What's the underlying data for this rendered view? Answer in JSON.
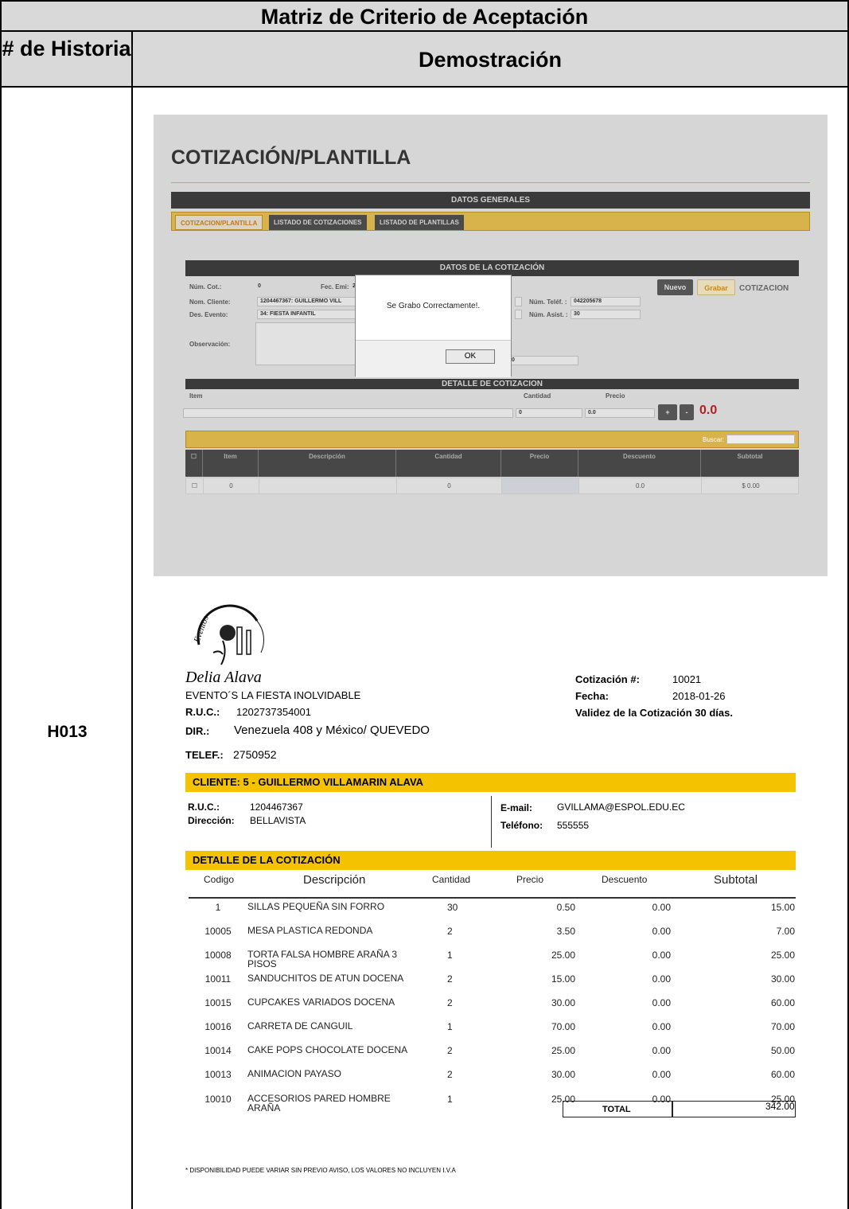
{
  "matrix": {
    "title": "Matriz de Criterio de Aceptación",
    "col1_header": "# de Historia",
    "col2_header": "Demostración",
    "story_id": "H013"
  },
  "app": {
    "page_title": "COTIZACIÓN/PLANTILLA",
    "general_bar": "DATOS GENERALES",
    "tabs": [
      "COTIZACION/PLANTILLA",
      "LISTADO DE COTIZACIONES",
      "LISTADO DE PLANTILLAS"
    ],
    "quote_bar": "DATOS DE LA COTIZACIÓN",
    "labels": {
      "num_cot": "Núm. Cot.:",
      "fec_emi": "Fec. Emi:",
      "nom_cliente": "Nom. Cliente:",
      "des_evento": "Des. Evento:",
      "observacion": "Observación:",
      "num_telef": "Núm. Teléf. :",
      "num_asist": "Núm. Asist. :"
    },
    "values": {
      "num_cot": "0",
      "fec_emi": "2",
      "nom_cliente": "1204467367: GUILLERMO VILL",
      "des_evento": "34: FIESTA INFANTIL",
      "num_telef": "042205678",
      "num_asist": "30",
      "obs_extra": "0"
    },
    "buttons": {
      "nuevo": "Nuevo",
      "grabar": "Grabar",
      "tipo": "COTIZACION"
    },
    "detail_bar": "DETALLE DE COTIZACION",
    "detail_labels": {
      "item": "Item",
      "cantidad": "Cantidad",
      "precio": "Precio"
    },
    "detail_values": {
      "cantidad": "0",
      "precio": "0.0",
      "total": "0.0"
    },
    "detail_buttons": {
      "plus": "+",
      "minus": "-"
    },
    "search_label": "Buscar:",
    "grid_headers": [
      "Item",
      "Descripción",
      "Cantidad",
      "Precio",
      "Descuento",
      "Subtotal"
    ],
    "grid_row": {
      "item": "0",
      "descripcion": "",
      "cantidad": "0",
      "precio": "",
      "descuento": "0.0",
      "subtotal": "$ 0.00"
    },
    "dialog": {
      "message": "Se Grabo Correctamente!.",
      "ok": "OK"
    },
    "colors": {
      "accent": "#f5c200",
      "dark_bar": "#3a3a3a",
      "total_red": "#b32020"
    }
  },
  "quote": {
    "logo_text": "Eventos",
    "brand": "Delia Alava",
    "company": "EVENTO´S LA FIESTA INOLVIDABLE",
    "ruc_label": "R.U.C.:",
    "ruc": "1202737354001",
    "dir_label": "DIR.:",
    "dir": "Venezuela 408 y México/ QUEVEDO",
    "telef_label": "TELEF.:",
    "telef": "2750952",
    "cot_label": "Cotización #:",
    "cot_num": "10021",
    "fecha_label": "Fecha:",
    "fecha": "2018-01-26",
    "validez": "Validez de la Cotización 30 días.",
    "client_bar": "CLIENTE: 5 - GUILLERMO VILLAMARIN ALAVA",
    "client_ruc_label": "R.U.C.:",
    "client_ruc": "1204467367",
    "client_dir_label": "Dirección:",
    "client_dir": "BELLAVISTA",
    "email_label": "E-mail:",
    "email": "GVILLAMA@ESPOL.EDU.EC",
    "tel_label": "Teléfono:",
    "tel": "555555",
    "detail_bar": "DETALLE DE LA COTIZACIÓN",
    "headers": [
      "Codigo",
      "Descripción",
      "Cantidad",
      "Precio",
      "Descuento",
      "Subtotal"
    ],
    "rows": [
      {
        "codigo": "1",
        "descripcion": "SILLAS PEQUEÑA SIN FORRO",
        "cantidad": "30",
        "precio": "0.50",
        "descuento": "0.00",
        "subtotal": "15.00"
      },
      {
        "codigo": "10005",
        "descripcion": "MESA PLASTICA REDONDA",
        "cantidad": "2",
        "precio": "3.50",
        "descuento": "0.00",
        "subtotal": "7.00"
      },
      {
        "codigo": "10008",
        "descripcion": "TORTA FALSA HOMBRE ARAÑA 3 PISOS",
        "cantidad": "1",
        "precio": "25.00",
        "descuento": "0.00",
        "subtotal": "25.00"
      },
      {
        "codigo": "10011",
        "descripcion": "SANDUCHITOS DE ATUN DOCENA",
        "cantidad": "2",
        "precio": "15.00",
        "descuento": "0.00",
        "subtotal": "30.00"
      },
      {
        "codigo": "10015",
        "descripcion": "CUPCAKES VARIADOS DOCENA",
        "cantidad": "2",
        "precio": "30.00",
        "descuento": "0.00",
        "subtotal": "60.00"
      },
      {
        "codigo": "10016",
        "descripcion": "CARRETA DE CANGUIL",
        "cantidad": "1",
        "precio": "70.00",
        "descuento": "0.00",
        "subtotal": "70.00"
      },
      {
        "codigo": "10014",
        "descripcion": "CAKE POPS CHOCOLATE DOCENA",
        "cantidad": "2",
        "precio": "25.00",
        "descuento": "0.00",
        "subtotal": "50.00"
      },
      {
        "codigo": "10013",
        "descripcion": "ANIMACION PAYASO",
        "cantidad": "2",
        "precio": "30.00",
        "descuento": "0.00",
        "subtotal": "60.00"
      },
      {
        "codigo": "10010",
        "descripcion": "ACCESORIOS PARED HOMBRE ARAÑA",
        "cantidad": "1",
        "precio": "25.00",
        "descuento": "0.00",
        "subtotal": "25.00"
      }
    ],
    "total_label": "TOTAL",
    "total": "342.00",
    "footnote": "* DISPONIBILIDAD PUEDE VARIAR SIN PREVIO AVISO, LOS VALORES NO INCLUYEN I.V.A"
  }
}
